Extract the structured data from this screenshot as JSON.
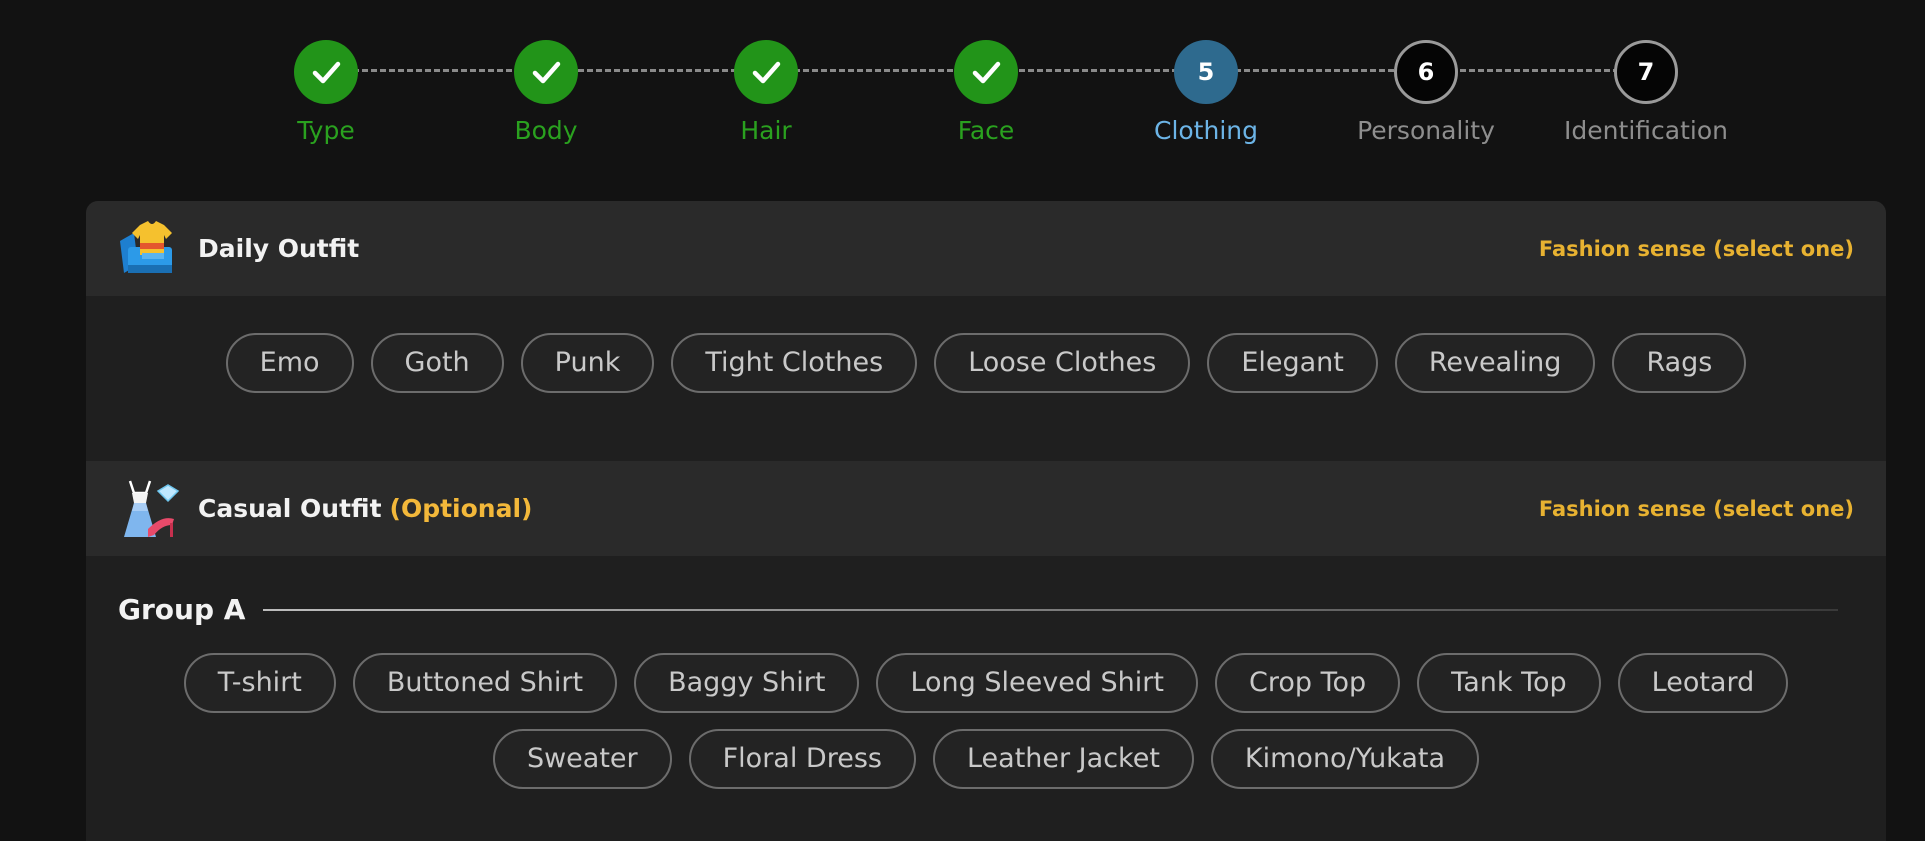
{
  "stepper": {
    "steps": [
      {
        "number": "1",
        "label": "Type",
        "state": "done"
      },
      {
        "number": "2",
        "label": "Body",
        "state": "done"
      },
      {
        "number": "3",
        "label": "Hair",
        "state": "done"
      },
      {
        "number": "4",
        "label": "Face",
        "state": "done"
      },
      {
        "number": "5",
        "label": "Clothing",
        "state": "current"
      },
      {
        "number": "6",
        "label": "Personality",
        "state": "todo"
      },
      {
        "number": "7",
        "label": "Identification",
        "state": "todo"
      }
    ],
    "colors": {
      "done": "#229419",
      "current": "#2e6a8e",
      "todo": "#050505"
    }
  },
  "daily_outfit": {
    "title": "Daily Outfit",
    "hint": "Fashion sense (select one)",
    "icon": "clothes-pile-icon",
    "options": [
      "Emo",
      "Goth",
      "Punk",
      "Tight Clothes",
      "Loose Clothes",
      "Elegant",
      "Revealing",
      "Rags"
    ]
  },
  "casual_outfit": {
    "title": "Casual Outfit",
    "optional": "(Optional)",
    "hint": "Fashion sense (select one)",
    "icon": "dress-and-heel-icon",
    "group_a": {
      "title": "Group A",
      "row1": [
        "T-shirt",
        "Buttoned Shirt",
        "Baggy Shirt",
        "Long Sleeved Shirt",
        "Crop Top",
        "Tank Top",
        "Leotard"
      ],
      "row2": [
        "Sweater",
        "Floral Dress",
        "Leather Jacket",
        "Kimono/Yukata"
      ]
    }
  },
  "accent_color": "#e8b231"
}
